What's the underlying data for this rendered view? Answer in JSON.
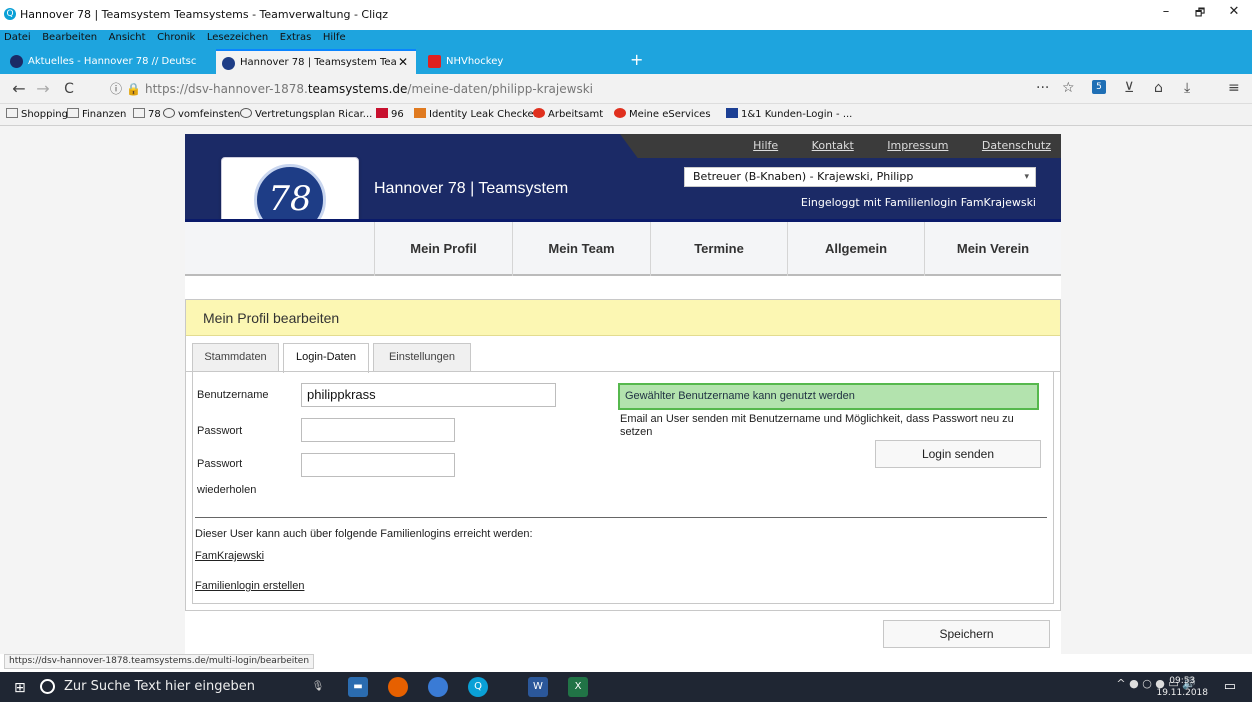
{
  "window": {
    "title": "Hannover 78 | Teamsystem Teamsystems - Teamverwaltung - Cliqz",
    "min": "–",
    "max": "🗗",
    "close": "✕"
  },
  "menubar": [
    "Datei",
    "Bearbeiten",
    "Ansicht",
    "Chronik",
    "Lesezeichen",
    "Extras",
    "Hilfe"
  ],
  "tabs": [
    {
      "label": "Aktuelles - Hannover 78 // Deutsc",
      "icon_color": "#1b2a66"
    },
    {
      "label": "Hannover 78 | Teamsystem Tea",
      "icon_color": "#1e3d86",
      "close": "✕"
    },
    {
      "label": "NHVhockey",
      "icon_color": "#e02020"
    }
  ],
  "new_tab": "+",
  "nav": {
    "back": "←",
    "forward": "→",
    "reload": "C",
    "url_prefix": "https://dsv-hannover-1878.",
    "url_domain": "teamsystems.de",
    "url_path": "/meine-daten/philipp-krajewski",
    "more": "···",
    "star": "☆",
    "badge": "5",
    "home": "⌂",
    "download": "⤓",
    "menu": "≡"
  },
  "bookmarks": [
    {
      "label": "Shopping"
    },
    {
      "label": "Finanzen"
    },
    {
      "label": "78"
    },
    {
      "label": "vomfeinsten"
    },
    {
      "label": "Vertretungsplan Ricar..."
    },
    {
      "label": "96"
    },
    {
      "label": "Identity Leak Checker"
    },
    {
      "label": "Arbeitsamt"
    },
    {
      "label": "Meine eServices"
    },
    {
      "label": "1&1 Kunden-Login - ..."
    }
  ],
  "site": {
    "top_links": [
      "Hilfe",
      "Kontakt",
      "Impressum",
      "Datenschutz"
    ],
    "logo_text": "78",
    "title": "Hannover 78 | Teamsystem",
    "role_select": "Betreuer (B-Knaben) - Krajewski, Philipp",
    "logged_in": "Eingeloggt mit Familienlogin FamKrajewski",
    "main_nav": [
      "Mein Profil",
      "Mein Team",
      "Termine",
      "Allgemein",
      "Mein Verein"
    ]
  },
  "profile": {
    "heading": "Mein Profil bearbeiten",
    "tabs": [
      "Stammdaten",
      "Login-Daten",
      "Einstellungen"
    ],
    "username_label": "Benutzername",
    "username_value": "philippkrass",
    "password_label": "Passwort",
    "password_repeat_label_1": "Passwort",
    "password_repeat_label_2": "wiederholen",
    "ok_message": "Gewählter Benutzername kann genutzt werden",
    "email_info": "Email an User senden mit Benutzername und Möglichkeit, dass Passwort neu zu setzen",
    "login_send_button": "Login senden",
    "family_info": "Dieser User kann auch über folgende Familienlogins erreicht werden:",
    "family_link": "FamKrajewski",
    "create_family_link": "Familienlogin erstellen",
    "save_button": "Speichern"
  },
  "status_url": "https://dsv-hannover-1878.teamsystems.de/multi-login/bearbeiten",
  "taskbar": {
    "search_placeholder": "Zur Suche Text hier eingeben",
    "time": "09:53",
    "date": "19.11.2018"
  }
}
